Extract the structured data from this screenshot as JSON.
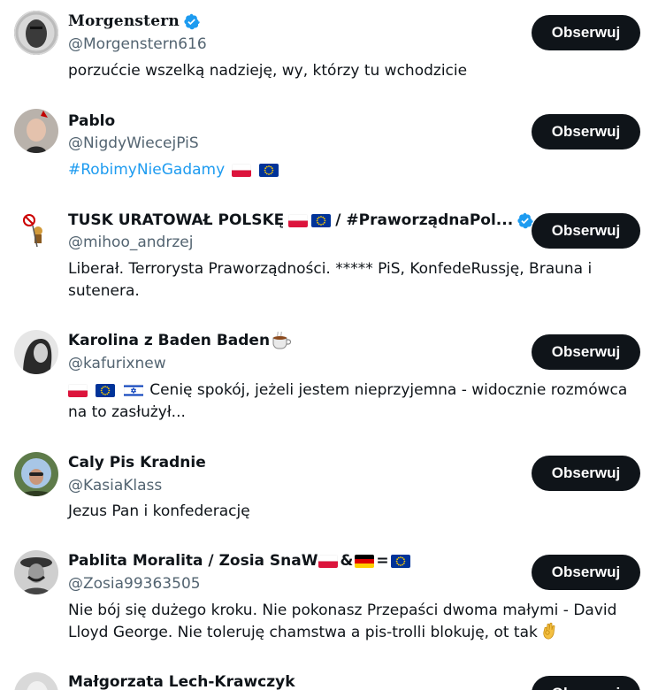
{
  "follow_label": "Obserwuj",
  "colors": {
    "text": "#0f1419",
    "secondary": "#536471",
    "link": "#1d9bf0",
    "verified": "#1d9bf0",
    "button_bg": "#0f1419"
  },
  "users": [
    {
      "name": "Morgenstern",
      "handle": "@Morgenstern616",
      "verified": true,
      "bio": "porzućcie wszelką nadzieję, wy, którzy tu wchodzicie"
    },
    {
      "name": "Pablo",
      "handle": "@NigdyWiecejPiS",
      "verified": false,
      "bio_link": "#RobimyNieGadamy",
      "bio_icons": [
        "flag-poland-icon",
        "flag-eu-icon"
      ]
    },
    {
      "name_part1": "TUSK URATOWAŁ POLSKĘ",
      "name_part2": "/ #PraworządnaPol...",
      "handle": "@mihoo_andrzej",
      "verified": true,
      "bio_line1": "Liberał. Terrorysta Praworządności. ***** PiS, KonfedeRussję, Brauna i",
      "bio_line2": "sutenera."
    },
    {
      "name": "Karolina z Baden Baden",
      "handle": "@kafurixnew",
      "verified": false,
      "name_icon": "coffee-cup-icon",
      "bio_line1": "Cenię spokój, jeżeli jestem nieprzyjemna - widocznie rozmówca",
      "bio_line2": "na to zasłużył..."
    },
    {
      "name": "Caly Pis Kradnie",
      "handle": "@KasiaKlass",
      "verified": false,
      "bio": "Jezus Pan i konfederację"
    },
    {
      "name_part1": "Pablita Moralita / Zosia SnaW",
      "amp": "&",
      "eq": "=",
      "handle": "@Zosia99363505",
      "verified": false,
      "bio_line1": "Nie bój się dużego kroku. Nie pokonasz Przepaści dwoma małymi - David",
      "bio_line2": "Lloyd George. Nie toleruję chamstwa a pis-trolli blokuję, ot tak",
      "bio_icon": "ok-hand-icon"
    },
    {
      "name": "Małgorzata Lech-Krawczyk"
    }
  ]
}
